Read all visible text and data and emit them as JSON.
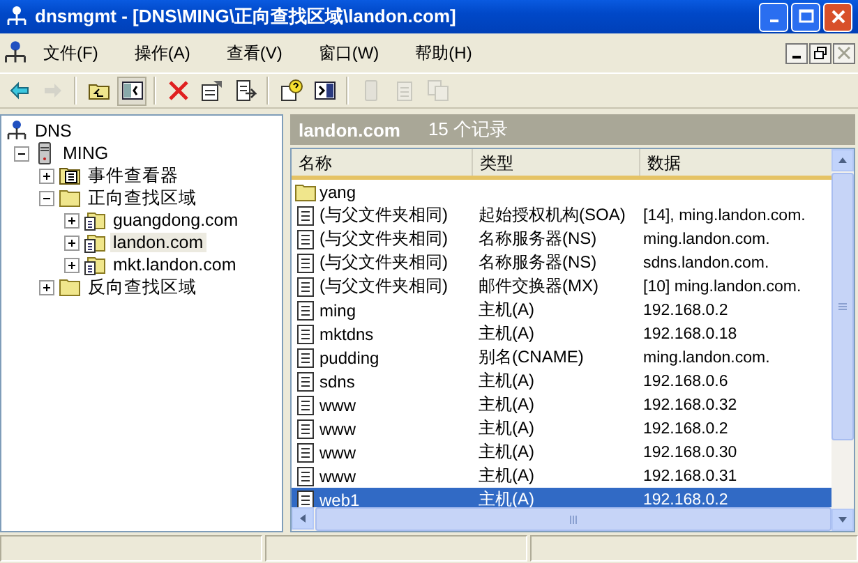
{
  "window": {
    "title": "dnsmgmt - [DNS\\MING\\正向查找区域\\landon.com]"
  },
  "menu": [
    "文件(F)",
    "操作(A)",
    "查看(V)",
    "窗口(W)",
    "帮助(H)"
  ],
  "toolbar": [
    {
      "kind": "back",
      "disabled": false,
      "selected": false
    },
    {
      "kind": "forward",
      "disabled": true,
      "selected": false
    },
    {
      "kind": "up",
      "disabled": false,
      "selected": false
    },
    {
      "kind": "tree",
      "disabled": false,
      "selected": true
    },
    {
      "kind": "delete",
      "disabled": false,
      "selected": false
    },
    {
      "kind": "properties",
      "disabled": false,
      "selected": false
    },
    {
      "kind": "export",
      "disabled": false,
      "selected": false
    },
    {
      "kind": "help",
      "disabled": false,
      "selected": false
    },
    {
      "kind": "panel",
      "disabled": false,
      "selected": false
    },
    {
      "kind": "server",
      "disabled": true,
      "selected": false
    },
    {
      "kind": "notes",
      "disabled": true,
      "selected": false
    },
    {
      "kind": "copy",
      "disabled": true,
      "selected": false
    }
  ],
  "tree": [
    {
      "label": "DNS",
      "kind": "root",
      "expanded": true,
      "selected": false,
      "children": [
        {
          "label": "MING",
          "kind": "server",
          "expanded": true,
          "selected": false,
          "children": [
            {
              "label": "事件查看器",
              "kind": "log",
              "expanded": false,
              "selected": false
            },
            {
              "label": "正向查找区域",
              "kind": "folder",
              "expanded": true,
              "selected": false,
              "children": [
                {
                  "label": "guangdong.com",
                  "kind": "zone",
                  "expanded": false,
                  "selected": false
                },
                {
                  "label": "landon.com",
                  "kind": "zone",
                  "expanded": false,
                  "selected": true
                },
                {
                  "label": "mkt.landon.com",
                  "kind": "zone",
                  "expanded": false,
                  "selected": false
                }
              ]
            },
            {
              "label": "反向查找区域",
              "kind": "folder",
              "expanded": false,
              "selected": false
            }
          ]
        }
      ]
    }
  ],
  "details": {
    "title": "landon.com",
    "count": "15 个记录"
  },
  "columns": [
    "名称",
    "类型",
    "数据"
  ],
  "rows": [
    {
      "kind": "folder",
      "name": "yang",
      "selected": false
    },
    {
      "kind": "record",
      "name": "(与父文件夹相同)",
      "type": "起始授权机构(SOA)",
      "data": "[14], ming.landon.com.",
      "selected": false
    },
    {
      "kind": "record",
      "name": "(与父文件夹相同)",
      "type": "名称服务器(NS)",
      "data": "ming.landon.com.",
      "selected": false
    },
    {
      "kind": "record",
      "name": "(与父文件夹相同)",
      "type": "名称服务器(NS)",
      "data": "sdns.landon.com.",
      "selected": false
    },
    {
      "kind": "record",
      "name": "(与父文件夹相同)",
      "type": "邮件交换器(MX)",
      "data": "[10]  ming.landon.com.",
      "selected": false
    },
    {
      "kind": "record",
      "name": "ming",
      "type": "主机(A)",
      "data": "192.168.0.2",
      "selected": false
    },
    {
      "kind": "record",
      "name": "mktdns",
      "type": "主机(A)",
      "data": "192.168.0.18",
      "selected": false
    },
    {
      "kind": "record",
      "name": "pudding",
      "type": "别名(CNAME)",
      "data": "ming.landon.com.",
      "selected": false
    },
    {
      "kind": "record",
      "name": "sdns",
      "type": "主机(A)",
      "data": "192.168.0.6",
      "selected": false
    },
    {
      "kind": "record",
      "name": "www",
      "type": "主机(A)",
      "data": "192.168.0.32",
      "selected": false
    },
    {
      "kind": "record",
      "name": "www",
      "type": "主机(A)",
      "data": "192.168.0.2",
      "selected": false
    },
    {
      "kind": "record",
      "name": "www",
      "type": "主机(A)",
      "data": "192.168.0.30",
      "selected": false
    },
    {
      "kind": "record",
      "name": "www",
      "type": "主机(A)",
      "data": "192.168.0.31",
      "selected": false
    },
    {
      "kind": "record",
      "name": "web1",
      "type": "主机(A)",
      "data": "192.168.0.2",
      "selected": true
    }
  ]
}
